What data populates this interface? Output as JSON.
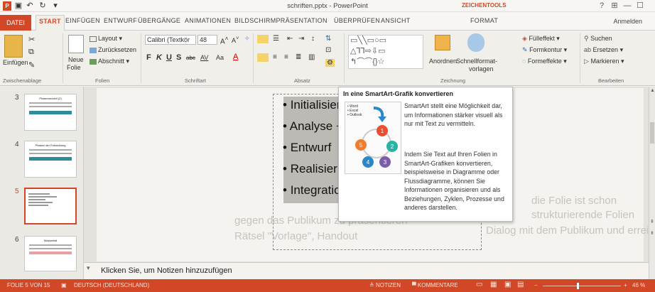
{
  "titlebar": {
    "doc_title": "schriften.pptx - PowerPoint",
    "tools_label": "ZEICHENTOOLS",
    "min": "—",
    "max": "☐",
    "help": "?"
  },
  "tabs": {
    "file": "DATEI",
    "items": [
      "START",
      "EINFÜGEN",
      "ENTWURF",
      "ÜBERGÄNGE",
      "ANIMATIONEN",
      "BILDSCHIRMPRÄSENTATION",
      "ÜBERPRÜFEN",
      "ANSICHT",
      "FORMAT"
    ],
    "signin": "Anmelden"
  },
  "ribbon": {
    "paste_label": "Einfügen",
    "clipboard_group": "Zwischenablage",
    "new_slide_line1": "Neue",
    "new_slide_line2": "Folie",
    "layout": "Layout",
    "reset": "Zurücksetzen",
    "section": "Abschnitt",
    "slides_group": "Folien",
    "font_name": "Calibri (Textkör",
    "font_size": "48",
    "bold": "F",
    "italic": "K",
    "underline": "U",
    "shadow": "S",
    "strike": "abc",
    "spacing": "AV",
    "case": "Aa",
    "font_group": "Schriftart",
    "paragraph_group": "Absatz",
    "arrange": "Anordnen",
    "quick_styles_line1": "Schnellformat-",
    "quick_styles_line2": "vorlagen",
    "drawing_group": "Zeichnung",
    "fill": "Fülleffekt",
    "outline": "Formkontur",
    "effects": "Formeffekte",
    "find": "Suchen",
    "replace": "Ersetzen",
    "select": "Markieren",
    "editing_group": "Bearbeiten"
  },
  "thumbnails": [
    {
      "num": "3",
      "title": "Phasenmodell (2)",
      "selected": false
    },
    {
      "num": "4",
      "title": "Phasen der Entwicklung",
      "selected": false
    },
    {
      "num": "5",
      "title": "",
      "selected": true
    },
    {
      "num": "6",
      "title": "Wasserfall",
      "selected": false
    }
  ],
  "slide": {
    "bullets": [
      "Initialisierung",
      "Analyse + Spezifikation",
      "Entwurf",
      "Realisierung",
      "Integration"
    ],
    "bg_text_1": "gegen das Publikum zu präsentieren",
    "bg_text_2": "Rätsel \"Vorlage\", Handout",
    "bg_text_3": "die Folie ist schon",
    "bg_text_4": "strukturierende Folien",
    "bg_text_5": "Dialog mit dem Publikum und erreichen"
  },
  "tooltip": {
    "title": "In eine SmartArt-Grafik konvertieren",
    "para1": "SmartArt stellt eine Möglichkeit dar, um Informationen stärker visuell als nur mit Text zu vermitteln.",
    "para2": "Indem Sie Text auf Ihren Folien in SmartArt-Grafiken konvertieren, beispielsweise in Diagramme oder Flussdiagramme, können Sie Informationen organisieren und als Beziehungen, Zyklen, Prozesse und anderes darstellen.",
    "preview_lines": [
      "Word",
      "Excel",
      "Outlook"
    ],
    "cycle_numbers": [
      "1",
      "2",
      "3",
      "4",
      "5"
    ]
  },
  "notes": {
    "placeholder": "Klicken Sie, um Notizen hinzuzufügen"
  },
  "status": {
    "slide_info": "FOLIE 5 VON 15",
    "language": "DEUTSCH (DEUTSCHLAND)",
    "notes": "NOTIZEN",
    "comments": "KOMMENTARE",
    "zoom": "46 %"
  },
  "colors": {
    "accent": "#d24726",
    "cycle": [
      "#e8502f",
      "#2bb3a2",
      "#7b5ea7",
      "#2b87c8",
      "#f07d2b"
    ]
  }
}
